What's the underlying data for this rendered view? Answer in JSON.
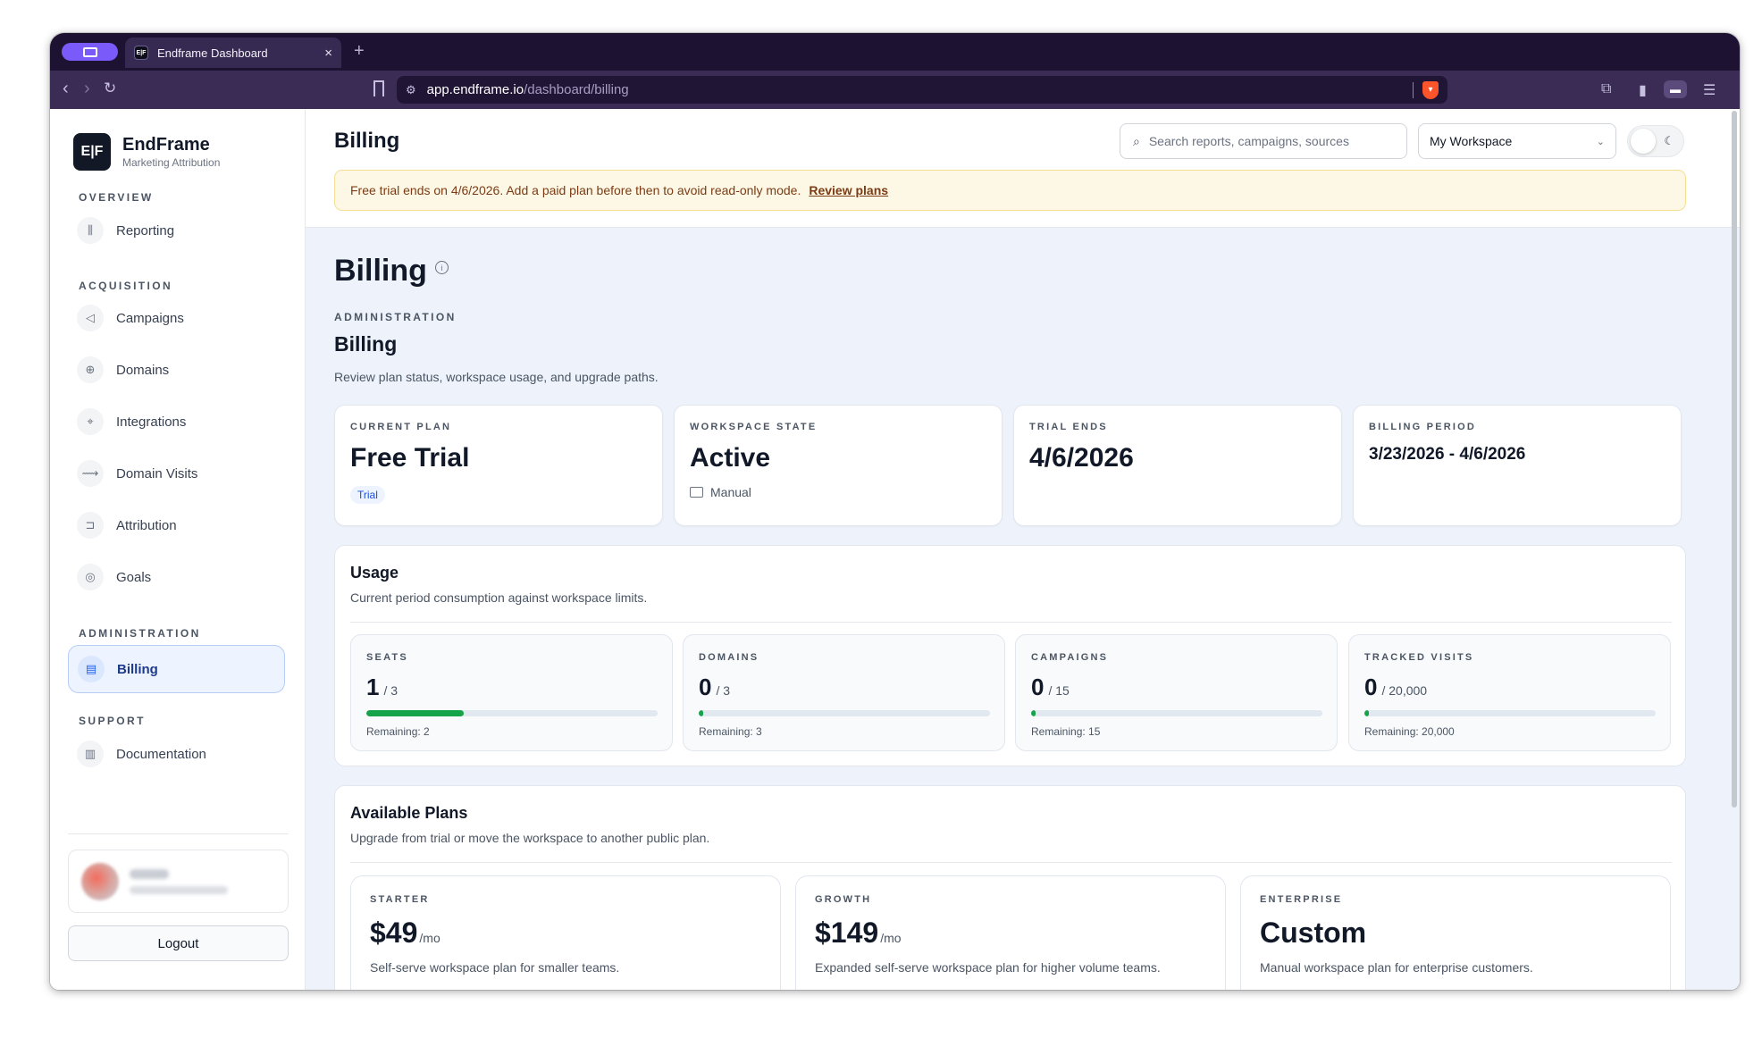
{
  "browser": {
    "tab_title": "Endframe Dashboard",
    "tab_favicon": "E|F",
    "new_tab": "+",
    "close": "×",
    "url_host": "app.endframe.io",
    "url_path": "/dashboard/billing"
  },
  "brand": {
    "logo": "E|F",
    "name": "EndFrame",
    "subtitle": "Marketing Attribution"
  },
  "sidebar": {
    "sections": {
      "overview": "OVERVIEW",
      "acquisition": "ACQUISITION",
      "administration": "ADMINISTRATION",
      "support": "SUPPORT"
    },
    "items": {
      "reporting": "Reporting",
      "campaigns": "Campaigns",
      "domains": "Domains",
      "integrations": "Integrations",
      "domain_visits": "Domain Visits",
      "attribution": "Attribution",
      "goals": "Goals",
      "billing": "Billing",
      "documentation": "Documentation"
    },
    "logout": "Logout"
  },
  "header": {
    "title": "Billing",
    "search_placeholder": "Search reports, campaigns, sources",
    "workspace": "My Workspace"
  },
  "banner": {
    "text": "Free trial ends on 4/6/2026. Add a paid plan before then to avoid read-only mode.",
    "link": "Review plans"
  },
  "page": {
    "title": "Billing",
    "eyebrow": "ADMINISTRATION",
    "subtitle": "Billing",
    "description": "Review plan status, workspace usage, and upgrade paths."
  },
  "stats": {
    "current_plan": {
      "label": "CURRENT PLAN",
      "value": "Free Trial",
      "badge": "Trial"
    },
    "workspace_state": {
      "label": "WORKSPACE STATE",
      "value": "Active",
      "note": "Manual"
    },
    "trial_ends": {
      "label": "TRIAL ENDS",
      "value": "4/6/2026"
    },
    "billing_period": {
      "label": "BILLING PERIOD",
      "value": "3/23/2026 - 4/6/2026"
    }
  },
  "usage": {
    "title": "Usage",
    "description": "Current period consumption against workspace limits.",
    "seats": {
      "label": "SEATS",
      "used": "1",
      "limit": "/ 3",
      "remaining": "Remaining: 2",
      "fraction": 0.333
    },
    "domains": {
      "label": "DOMAINS",
      "used": "0",
      "limit": "/ 3",
      "remaining": "Remaining: 3",
      "fraction": 0.0
    },
    "campaigns": {
      "label": "CAMPAIGNS",
      "used": "0",
      "limit": "/ 15",
      "remaining": "Remaining: 15",
      "fraction": 0.0
    },
    "tracked_visits": {
      "label": "TRACKED VISITS",
      "used": "0",
      "limit": "/ 20,000",
      "remaining": "Remaining: 20,000",
      "fraction": 0.0
    }
  },
  "plans": {
    "title": "Available Plans",
    "description": "Upgrade from trial or move the workspace to another public plan.",
    "starter": {
      "label": "STARTER",
      "price": "$49",
      "period": "/mo",
      "description": "Self-serve workspace plan for smaller teams."
    },
    "growth": {
      "label": "GROWTH",
      "price": "$149",
      "period": "/mo",
      "description": "Expanded self-serve workspace plan for higher volume teams."
    },
    "enterprise": {
      "label": "ENTERPRISE",
      "price": "Custom",
      "description": "Manual workspace plan for enterprise customers."
    }
  },
  "colors": {
    "accent": "#2563eb",
    "progress": "#16a34a",
    "banner_bg": "#fdf8e5",
    "chrome": "#1e1232"
  }
}
